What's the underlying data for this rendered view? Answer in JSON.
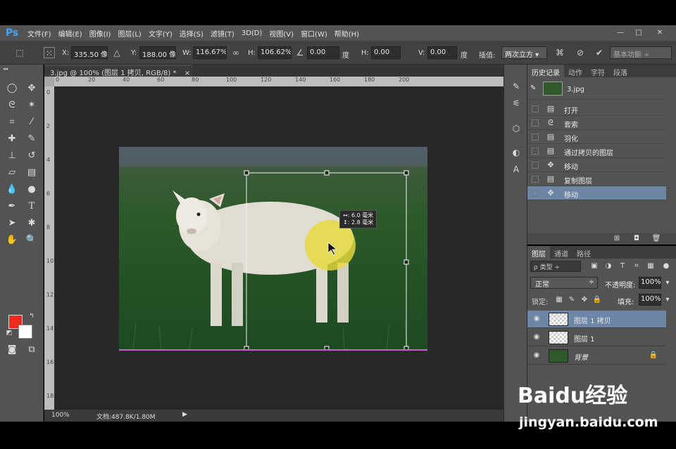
{
  "app": {
    "logo": "Ps",
    "menu": [
      "文件(F)",
      "编辑(E)",
      "图像(I)",
      "图层(L)",
      "文字(Y)",
      "选择(S)",
      "滤镜(T)",
      "3D(D)",
      "视图(V)",
      "窗口(W)",
      "帮助(H)"
    ],
    "window_controls": [
      "—",
      "□",
      "✕"
    ]
  },
  "options": {
    "x_label": "X:",
    "x_value": "335.50 像素",
    "y_label": "Y:",
    "y_value": "188.00 像素",
    "w_label": "W:",
    "w_value": "116.67%",
    "h_label": "H:",
    "h_value": "106.62%",
    "angle_value": "0.00",
    "degree": "度",
    "hskew_label": "H:",
    "hskew_value": "0.00",
    "vskew_label": "V:",
    "vskew_value": "0.00",
    "interp_label": "插值:",
    "interp_value": "两次立方",
    "workspace": "基本功能"
  },
  "document": {
    "tab_title": "3.jpg @ 100% (图层 1 拷贝, RGB/8) *",
    "tab_close": "×",
    "ruler_h": [
      "0",
      "20",
      "40",
      "60",
      "80",
      "100",
      "120",
      "140",
      "160",
      "180",
      "200"
    ],
    "ruler_v": [
      "0",
      "2",
      "4",
      "6",
      "8",
      "10",
      "12",
      "14",
      "16",
      "18"
    ],
    "zoom": "100%",
    "doc_info": "文档:487.8K/1.80M",
    "transform_tooltip_line1": "↔: 6.0 毫米",
    "transform_tooltip_line2": "↕: 2.8 毫米"
  },
  "history": {
    "tabs": [
      "历史记录",
      "动作",
      "字符",
      "段落"
    ],
    "snapshot": "3.jpg",
    "items": [
      {
        "label": "打开",
        "icon": "document-icon"
      },
      {
        "label": "套索",
        "icon": "lasso-icon"
      },
      {
        "label": "羽化",
        "icon": "document-icon"
      },
      {
        "label": "通过拷贝的图层",
        "icon": "document-icon"
      },
      {
        "label": "移动",
        "icon": "move-icon"
      },
      {
        "label": "复制图层",
        "icon": "document-icon"
      },
      {
        "label": "移动",
        "icon": "move-icon"
      }
    ]
  },
  "layers": {
    "tabs": [
      "图层",
      "通道",
      "路径"
    ],
    "filter_label": "ρ 类型",
    "blend_mode": "正常",
    "opacity_label": "不透明度:",
    "opacity_value": "100%",
    "lock_label": "锁定:",
    "fill_label": "填充:",
    "fill_value": "100%",
    "items": [
      {
        "name": "图层 1 拷贝",
        "selected": true
      },
      {
        "name": "图层 1",
        "selected": false
      },
      {
        "name": "背景",
        "selected": false
      }
    ]
  },
  "watermark": {
    "brand": "Baidu经验",
    "url": "jingyan.baidu.com"
  },
  "colors": {
    "foreground": "#f02a1c",
    "background": "#ffffff",
    "selection": "#6e86a6",
    "ps_blue": "#3fa7ff"
  }
}
